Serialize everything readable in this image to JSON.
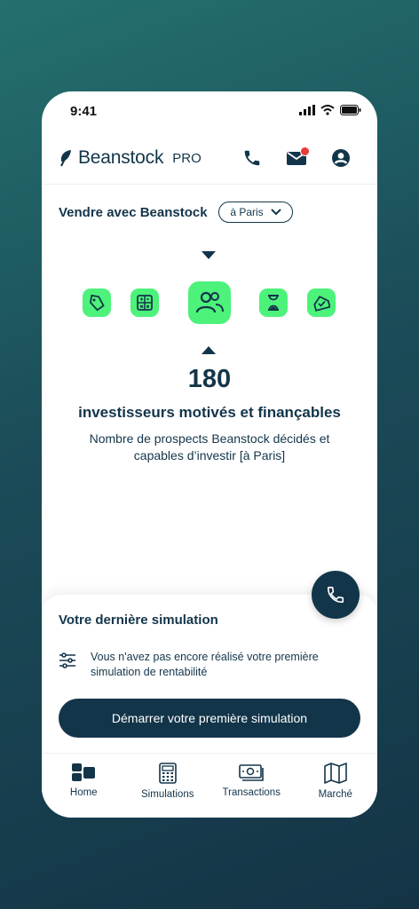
{
  "status": {
    "time": "9:41"
  },
  "brand": {
    "name": "Beanstock",
    "tier": "PRO"
  },
  "header": {
    "icons": [
      "phone-icon",
      "mail-icon",
      "profile-icon"
    ],
    "notification": true
  },
  "sell": {
    "title": "Vendre avec Beanstock",
    "city": "à Paris",
    "steps": [
      "tag-icon",
      "calculator-icon",
      "investors-icon",
      "hourglass-icon",
      "house-check-icon"
    ],
    "active_step": 2
  },
  "metric": {
    "value": "180",
    "headline": "investisseurs motivés et finançables",
    "description": "Nombre de prospects Beanstock décidés et capables d’investir [à Paris]"
  },
  "simulation": {
    "title": "Votre dernière simulation",
    "empty_text": "Vous n'avez pas encore réalisé votre première simulation de rentabilité",
    "cta": "Démarrer votre première simulation"
  },
  "tabs": [
    {
      "label": "Home",
      "icon": "home-icon"
    },
    {
      "label": "Simulations",
      "icon": "calculator-icon"
    },
    {
      "label": "Transactions",
      "icon": "banknote-icon"
    },
    {
      "label": "Marché",
      "icon": "map-icon"
    }
  ],
  "colors": {
    "primary": "#13354a",
    "accent": "#4df27a",
    "alert": "#e63b3b"
  }
}
